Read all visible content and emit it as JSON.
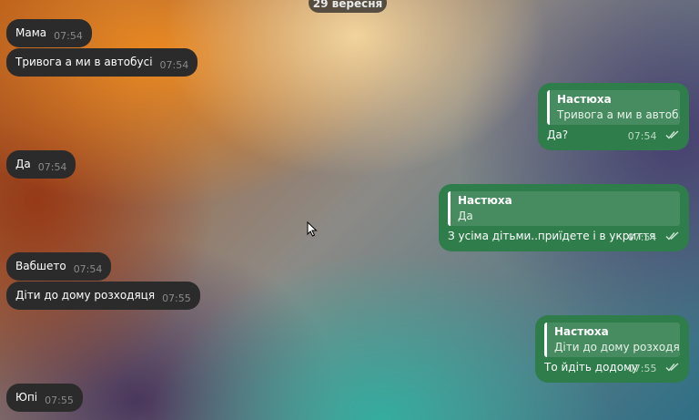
{
  "date_label": "29 вересня",
  "incoming": [
    {
      "text": "Мама",
      "time": "07:54"
    },
    {
      "text": "Тривога а ми в автобусі",
      "time": "07:54"
    },
    {
      "text": "Да",
      "time": "07:54"
    },
    {
      "text": "Вабшето",
      "time": "07:54"
    },
    {
      "text": "Діти до дому розходяця",
      "time": "07:55"
    },
    {
      "text": "Юпі",
      "time": "07:55"
    }
  ],
  "outgoing": [
    {
      "reply_name": "Настюха",
      "reply_text": "Тривога а ми в автоб...",
      "text": "Да?",
      "time": "07:54",
      "status": "read"
    },
    {
      "reply_name": "Настюха",
      "reply_text": "Да",
      "text": "З усіма дітьми..приїдете і в укриття",
      "time": "07:54",
      "status": "read"
    },
    {
      "reply_name": "Настюха",
      "reply_text": "Діти до дому розходя...",
      "text": "То йдіть додому",
      "time": "07:55",
      "status": "read"
    }
  ],
  "icons": {
    "read_status": "double-check-icon",
    "cursor": "mouse-pointer-icon"
  },
  "colors": {
    "incoming_bubble": "#2b2b2b",
    "outgoing_bubble": "#2e7d4a",
    "timestamp_in": "#8a8a8a",
    "timestamp_out": "#bcd8c5"
  }
}
